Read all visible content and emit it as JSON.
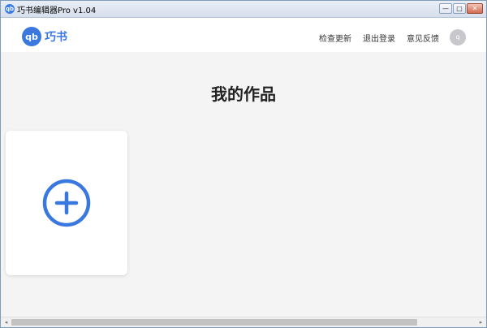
{
  "window": {
    "title": "巧书编辑器Pro v1.04",
    "app_icon_text": "qb",
    "controls": {
      "minimize": "—",
      "maximize": "□",
      "close": "✕"
    }
  },
  "header": {
    "logo_mark": "qb",
    "logo_text": "巧书",
    "nav": {
      "check_update": "检查更新",
      "logout": "退出登录",
      "feedback": "意见反馈"
    },
    "avatar_text": "q"
  },
  "main": {
    "title": "我的作品",
    "add_card": {
      "icon": "plus-circle-icon"
    }
  },
  "scrollbar": {
    "left_arrow": "◂",
    "right_arrow": "▸"
  },
  "colors": {
    "accent": "#3a78e0",
    "background": "#f4f4f5",
    "card": "#ffffff",
    "avatar": "#c8c8cc"
  }
}
